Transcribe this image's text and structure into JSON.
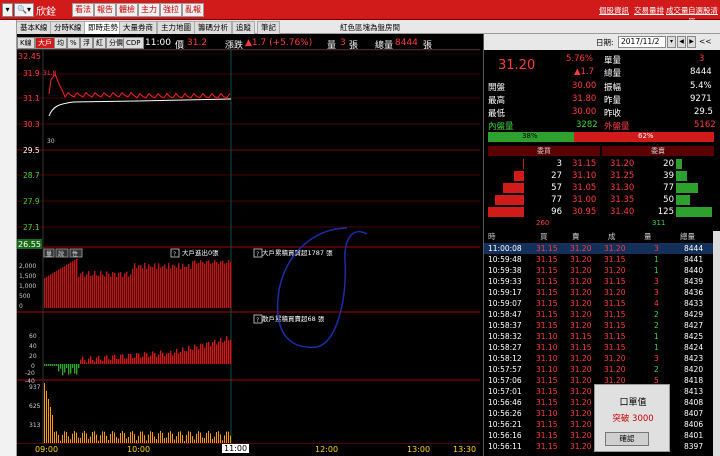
{
  "topbar": {
    "stock_name": "欣銓",
    "buttons": [
      "看法",
      "報告",
      "體檢",
      "主力",
      "強拉",
      "亂報"
    ],
    "right_links": [
      "個股資訊",
      "交易量排",
      "成交量",
      "自選股清單"
    ]
  },
  "tabs": [
    "基本K線",
    "分時K線",
    "即時走勢",
    "大量券商",
    "主力地圖",
    "籌碼分析",
    "追蹤",
    "筆記"
  ],
  "active_tab": 2,
  "notice": "紅色區塊為盤房間",
  "infobar": {
    "buttons": [
      "K線",
      "大戶",
      "均",
      "%",
      "浮",
      "紅",
      "分價",
      "CDP"
    ],
    "time": "11:00",
    "price_label": "價",
    "price": "31.2",
    "change_label": "漲跌",
    "change": "▲1.7 (+5.76%)",
    "vol_label": "量",
    "vol": "3",
    "vol_unit": "張",
    "total_label": "總量",
    "total": "8444",
    "total_unit": "張"
  },
  "chart": {
    "price_levels": [
      "32.45",
      "31.9",
      "31.1",
      "30.3",
      "29.5",
      "28.7",
      "27.9",
      "27.1",
      "26.55"
    ],
    "open_label": "31.8",
    "low_label": "30",
    "big_player_ticks": [
      "2,000",
      "1,500",
      "1,000",
      "500",
      "0"
    ],
    "diff_ticks": [
      "60",
      "40",
      "20",
      "0",
      "-20",
      "-40"
    ],
    "vol_ticks": [
      "937",
      "625",
      "313"
    ],
    "times": [
      "09:00",
      "10:00",
      "11:00",
      "12:00",
      "13:00",
      "13:30"
    ],
    "label_big_in": "大戶進出0張",
    "label_big_total": "大戶累積買賣超1787 張",
    "label_small_total": "散戶累積買賣超68 張",
    "mini_btns": [
      "量",
      "說",
      "性"
    ]
  },
  "chart_data": {
    "type": "line",
    "x": [
      "09:00",
      "09:15",
      "09:30",
      "09:45",
      "10:00",
      "10:15",
      "10:30",
      "10:45",
      "11:00"
    ],
    "series": [
      {
        "values": [
          31.4,
          31.2,
          31.1,
          31.2,
          31.3,
          31.2,
          31.2,
          31.2,
          31.2
        ]
      }
    ],
    "ylim": [
      26.55,
      32.45
    ]
  },
  "quote": {
    "price": "31.20",
    "change_pct": "5.76%",
    "change": "▲1.7",
    "single_label": "單量",
    "single": "3",
    "total_label": "總量",
    "total": "8444",
    "open_label": "開盤",
    "open": "30.00",
    "amp_label": "振幅",
    "amp": "5.4%",
    "high_label": "最高",
    "high": "31.80",
    "yvol_label": "昨量",
    "yvol": "9271",
    "low_label": "最低",
    "low": "30.00",
    "yclose_label": "昨收",
    "yclose": "29.5",
    "inner_label": "內盤量",
    "inner": "3282",
    "outer_label": "外盤量",
    "outer": "5162",
    "inner_pct": "38%",
    "outer_pct": "62%",
    "inner_frac": 0.38,
    "bid_hdr": "委買",
    "ask_hdr": "委賣"
  },
  "book": [
    {
      "bvol": "3",
      "bid": "31.15",
      "ask": "31.20",
      "avol": "20"
    },
    {
      "bvol": "27",
      "bid": "31.10",
      "ask": "31.25",
      "avol": "39"
    },
    {
      "bvol": "57",
      "bid": "31.05",
      "ask": "31.30",
      "avol": "77"
    },
    {
      "bvol": "77",
      "bid": "31.00",
      "ask": "31.35",
      "avol": "50"
    },
    {
      "bvol": "96",
      "bid": "30.95",
      "ask": "31.40",
      "avol": "125"
    }
  ],
  "book_totals": {
    "bid": "260",
    "ask": "311"
  },
  "tick_headers": [
    "時",
    "買",
    "賣",
    "成",
    "量",
    "總量"
  ],
  "ticks": [
    {
      "t": "11:00:08",
      "b": "31.15",
      "s": "31.20",
      "p": "31.20",
      "v": "3",
      "tv": "8444"
    },
    {
      "t": "10:59:48",
      "b": "31.15",
      "s": "31.20",
      "p": "31.15",
      "v": "1",
      "tv": "8441"
    },
    {
      "t": "10:59:38",
      "b": "31.15",
      "s": "31.20",
      "p": "31.20",
      "v": "1",
      "tv": "8440"
    },
    {
      "t": "10:59:33",
      "b": "31.15",
      "s": "31.20",
      "p": "31.15",
      "v": "3",
      "tv": "8439"
    },
    {
      "t": "10:59:17",
      "b": "31.15",
      "s": "31.20",
      "p": "31.20",
      "v": "3",
      "tv": "8436"
    },
    {
      "t": "10:59:07",
      "b": "31.15",
      "s": "31.20",
      "p": "31.15",
      "v": "4",
      "tv": "8433"
    },
    {
      "t": "10:58:47",
      "b": "31.15",
      "s": "31.20",
      "p": "31.15",
      "v": "2",
      "tv": "8429"
    },
    {
      "t": "10:58:37",
      "b": "31.15",
      "s": "31.20",
      "p": "31.15",
      "v": "2",
      "tv": "8427"
    },
    {
      "t": "10:58:32",
      "b": "31.10",
      "s": "31.15",
      "p": "31.15",
      "v": "1",
      "tv": "8425"
    },
    {
      "t": "10:58:27",
      "b": "31.10",
      "s": "31.15",
      "p": "31.15",
      "v": "1",
      "tv": "8424"
    },
    {
      "t": "10:58:12",
      "b": "31.10",
      "s": "31.20",
      "p": "31.20",
      "v": "3",
      "tv": "8423"
    },
    {
      "t": "10:57:57",
      "b": "31.10",
      "s": "31.20",
      "p": "31.20",
      "v": "2",
      "tv": "8420"
    },
    {
      "t": "10:57:06",
      "b": "31.15",
      "s": "31.20",
      "p": "31.20",
      "v": "5",
      "tv": "8418"
    },
    {
      "t": "10:57:01",
      "b": "31.15",
      "s": "31.20",
      "p": "31.20",
      "v": "5",
      "tv": "8413"
    },
    {
      "t": "10:56:46",
      "b": "31.15",
      "s": "31.20",
      "p": "31.20",
      "v": "1",
      "tv": "8408"
    },
    {
      "t": "10:56:26",
      "b": "31.10",
      "s": "31.20",
      "p": "31.20",
      "v": "1",
      "tv": "8407"
    },
    {
      "t": "10:56:21",
      "b": "31.15",
      "s": "31.20",
      "p": "31.20",
      "v": "5",
      "tv": "8406"
    },
    {
      "t": "10:56:16",
      "b": "31.15",
      "s": "31.20",
      "p": "31.20",
      "v": "4",
      "tv": "8401"
    },
    {
      "t": "10:56:11",
      "b": "31.15",
      "s": "31.20",
      "p": "31.20",
      "v": "4",
      "tv": "8397"
    }
  ],
  "date_label": "日期:",
  "date_value": "2017/11/2",
  "dialog": {
    "title": "口單值",
    "msg": "突破 3000",
    "btn": "確認"
  },
  "colors": {
    "up": "#ff3b3b",
    "down": "#3cd63c",
    "bar": "#d11b1b",
    "panel": "#000000"
  }
}
